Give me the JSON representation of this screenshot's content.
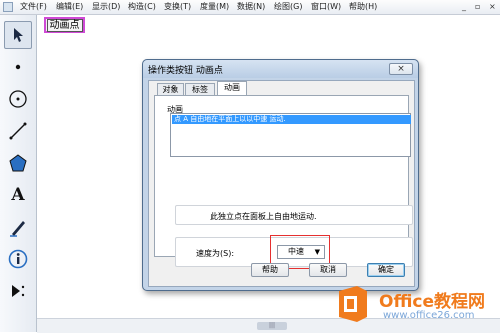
{
  "menubar": {
    "items": [
      "文件(F)",
      "编辑(E)",
      "显示(D)",
      "构造(C)",
      "变换(T)",
      "度量(M)",
      "数据(N)",
      "绘图(G)",
      "窗口(W)",
      "帮助(H)"
    ],
    "minimize": "_",
    "restore": "▫",
    "close": "×"
  },
  "toolbox": {
    "tools": [
      "arrow-tool-icon",
      "point-tool-icon",
      "compass-tool-icon",
      "line-tool-icon",
      "polygon-tool-icon",
      "text-tool-icon",
      "marker-tool-icon",
      "info-tool-icon",
      "custom-tool-icon"
    ],
    "text_glyph": "A"
  },
  "canvas": {
    "action_button_label": "动画点"
  },
  "dialog": {
    "title": "操作类按钮 动画点",
    "close_label": "×",
    "tabs": [
      "对象",
      "标签",
      "动画"
    ],
    "active_tab": "动画",
    "section_label": "动画",
    "list_items": [
      "点 A 自由地在平面上以以中速 运动."
    ],
    "description": "此独立点在面板上自由地运动.",
    "speed_label": "速度为(S):",
    "speed_value": "中速",
    "buttons": {
      "help": "帮助",
      "cancel": "取消",
      "ok": "确定"
    }
  },
  "watermark": {
    "title": "Office教程网",
    "url": "www.office26.com"
  },
  "colors": {
    "accent": "#3399ff",
    "highlight_box": "#e53030",
    "action_button_border": "#d04ad7",
    "watermark_orange": "#f07b1d"
  }
}
